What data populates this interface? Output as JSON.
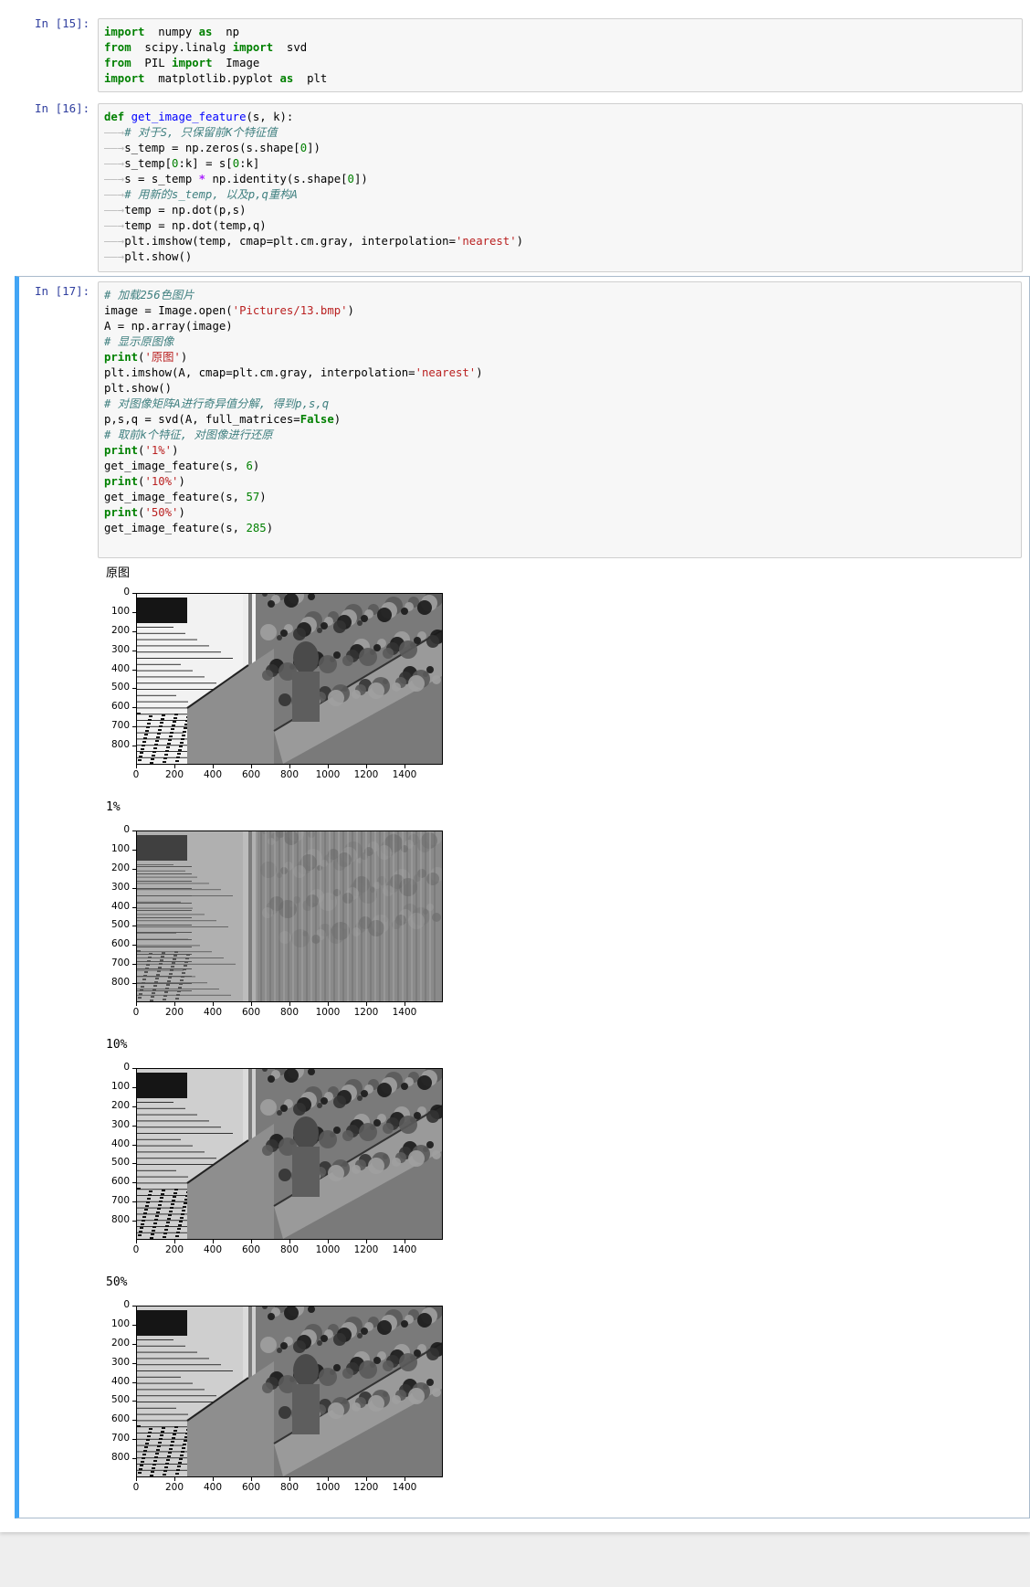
{
  "cells": [
    {
      "prompt": "In  [15]:",
      "lines": [
        [
          [
            "kw",
            "import"
          ],
          [
            "",
            "  numpy "
          ],
          [
            "kw",
            "as"
          ],
          [
            "",
            "  np"
          ]
        ],
        [
          [
            "kw",
            "from"
          ],
          [
            "",
            "  scipy.linalg "
          ],
          [
            "kw",
            "import"
          ],
          [
            "",
            "  svd"
          ]
        ],
        [
          [
            "kw",
            "from"
          ],
          [
            "",
            "  PIL "
          ],
          [
            "kw",
            "import"
          ],
          [
            "",
            "  Image"
          ]
        ],
        [
          [
            "kw",
            "import"
          ],
          [
            "",
            "  matplotlib.pyplot "
          ],
          [
            "kw",
            "as"
          ],
          [
            "",
            "  plt"
          ]
        ]
      ]
    },
    {
      "prompt": "In  [16]:",
      "lines": [
        [
          [
            "kw",
            "def"
          ],
          [
            "",
            " "
          ],
          [
            "fn",
            "get_image_feature"
          ],
          [
            "",
            "(s, k):"
          ]
        ],
        [
          [
            "tab",
            "——→"
          ],
          [
            "cm",
            "# 对于S, 只保留前K个特征值"
          ]
        ],
        [
          [
            "tab",
            "——→"
          ],
          [
            "",
            "s_temp = np.zeros(s.shape["
          ],
          [
            "num",
            "0"
          ],
          [
            "",
            "])"
          ]
        ],
        [
          [
            "tab",
            "——→"
          ],
          [
            "",
            "s_temp["
          ],
          [
            "num",
            "0"
          ],
          [
            "",
            ":k] = s["
          ],
          [
            "num",
            "0"
          ],
          [
            "",
            ":k]"
          ]
        ],
        [
          [
            "tab",
            "——→"
          ],
          [
            "",
            "s = s_temp "
          ],
          [
            "op",
            "*"
          ],
          [
            "",
            " np.identity(s.shape["
          ],
          [
            "num",
            "0"
          ],
          [
            "",
            "])"
          ]
        ],
        [
          [
            "tab",
            "——→"
          ],
          [
            "cm",
            "# 用新的s_temp, 以及p,q重构A"
          ]
        ],
        [
          [
            "tab",
            "——→"
          ],
          [
            "",
            "temp = np.dot(p,s)"
          ]
        ],
        [
          [
            "tab",
            "——→"
          ],
          [
            "",
            "temp = np.dot(temp,q)"
          ]
        ],
        [
          [
            "tab",
            "——→"
          ],
          [
            "",
            "plt.imshow(temp, cmap=plt.cm.gray, interpolation="
          ],
          [
            "str",
            "'nearest'"
          ],
          [
            "",
            ")"
          ]
        ],
        [
          [
            "tab",
            "——→"
          ],
          [
            "",
            "plt.show()"
          ]
        ]
      ]
    },
    {
      "prompt": "In  [17]:",
      "lines": [
        [
          [
            "cm",
            "# 加载256色图片"
          ]
        ],
        [
          [
            "",
            "image = Image.open("
          ],
          [
            "str",
            "'Pictures/13.bmp'"
          ],
          [
            "",
            ")"
          ]
        ],
        [
          [
            "",
            "A = np.array(image)"
          ]
        ],
        [
          [
            "cm",
            "# 显示原图像"
          ]
        ],
        [
          [
            "kw",
            "print"
          ],
          [
            "",
            "("
          ],
          [
            "str",
            "'原图'"
          ],
          [
            "",
            ")"
          ]
        ],
        [
          [
            "",
            "plt.imshow(A, cmap=plt.cm.gray, interpolation="
          ],
          [
            "str",
            "'nearest'"
          ],
          [
            "",
            ")"
          ]
        ],
        [
          [
            "",
            "plt.show()"
          ]
        ],
        [
          [
            "cm",
            "# 对图像矩阵A进行奇异值分解, 得到p,s,q"
          ]
        ],
        [
          [
            "",
            "p,s,q = svd(A, full_matrices="
          ],
          [
            "kw",
            "False"
          ],
          [
            "",
            ")"
          ]
        ],
        [
          [
            "cm",
            "# 取前k个特征, 对图像进行还原"
          ]
        ],
        [
          [
            "kw",
            "print"
          ],
          [
            "",
            "("
          ],
          [
            "str",
            "'1%'"
          ],
          [
            "",
            ")"
          ]
        ],
        [
          [
            "",
            "get_image_feature(s, "
          ],
          [
            "num",
            "6"
          ],
          [
            "",
            ")"
          ]
        ],
        [
          [
            "kw",
            "print"
          ],
          [
            "",
            "("
          ],
          [
            "str",
            "'10%'"
          ],
          [
            "",
            ")"
          ]
        ],
        [
          [
            "",
            "get_image_feature(s, "
          ],
          [
            "num",
            "57"
          ],
          [
            "",
            ")"
          ]
        ],
        [
          [
            "kw",
            "print"
          ],
          [
            "",
            "("
          ],
          [
            "str",
            "'50%'"
          ],
          [
            "",
            ")"
          ]
        ],
        [
          [
            "",
            "get_image_feature(s, "
          ],
          [
            "num",
            "285"
          ],
          [
            "",
            ")"
          ]
        ],
        [
          [
            "",
            ""
          ]
        ]
      ]
    }
  ],
  "outputs": [
    {
      "label": "原图",
      "variant": "original"
    },
    {
      "label": "1%",
      "variant": "k1"
    },
    {
      "label": "10%",
      "variant": "k10"
    },
    {
      "label": "50%",
      "variant": "k50"
    }
  ],
  "axes": {
    "yticks": [
      "0",
      "100",
      "200",
      "300",
      "400",
      "500",
      "600",
      "700",
      "800"
    ],
    "xticks": [
      "0",
      "200",
      "400",
      "600",
      "800",
      "1000",
      "1200",
      "1400"
    ],
    "ylim": [
      0,
      900
    ],
    "xlim": [
      0,
      1600
    ]
  }
}
